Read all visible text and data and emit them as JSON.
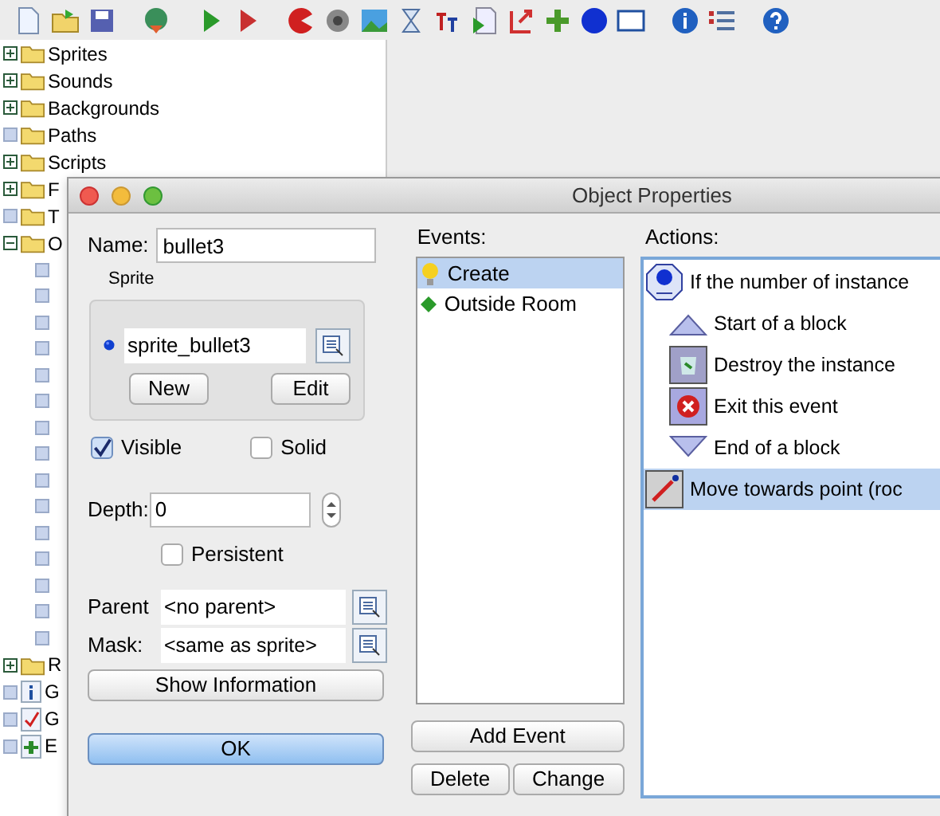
{
  "tree": [
    {
      "label": "Sprites",
      "expanded": false
    },
    {
      "label": "Sounds",
      "expanded": false
    },
    {
      "label": "Backgrounds",
      "expanded": false
    },
    {
      "label": "Paths"
    },
    {
      "label": "Scripts",
      "expanded": false
    },
    {
      "label": "F",
      "expanded": false
    },
    {
      "label": "T"
    },
    {
      "label": "O",
      "expanded": true,
      "children": [
        {
          "kind": "object"
        },
        {
          "kind": "object"
        },
        {
          "kind": "object"
        },
        {
          "kind": "object"
        },
        {
          "kind": "object"
        },
        {
          "kind": "object"
        },
        {
          "kind": "object"
        },
        {
          "kind": "object"
        },
        {
          "kind": "object"
        },
        {
          "kind": "object"
        },
        {
          "kind": "object"
        },
        {
          "kind": "object"
        },
        {
          "kind": "object"
        },
        {
          "kind": "object"
        },
        {
          "kind": "object"
        }
      ]
    },
    {
      "label": "R",
      "expanded": false,
      "kind": "folder"
    },
    {
      "label": "G",
      "kind": "info"
    },
    {
      "label": "G",
      "kind": "settings"
    },
    {
      "label": "E",
      "kind": "extension"
    }
  ],
  "dialog": {
    "title": "Object Properties",
    "name_label": "Name:",
    "name_value": "bullet3",
    "sprite_group": "Sprite",
    "sprite_value": "sprite_bullet3",
    "new_button": "New",
    "edit_button": "Edit",
    "visible": {
      "label": "Visible",
      "checked": true
    },
    "solid": {
      "label": "Solid",
      "checked": false
    },
    "depth_label": "Depth:",
    "depth_value": "0",
    "persistent": {
      "label": "Persistent",
      "checked": false
    },
    "parent_label": "Parent",
    "parent_value": "<no parent>",
    "mask_label": "Mask:",
    "mask_value": "<same as sprite>",
    "show_info_button": "Show Information",
    "ok_button": "OK",
    "events_label": "Events:",
    "events": [
      {
        "label": "Create",
        "kind": "create",
        "selected": true
      },
      {
        "label": "Outside Room",
        "kind": "other",
        "selected": false
      }
    ],
    "add_event_button": "Add Event",
    "delete_button": "Delete",
    "change_button": "Change",
    "actions_label": "Actions:",
    "actions": [
      {
        "label": "If the number of instance",
        "kind": "test",
        "selected": false,
        "children": [
          {
            "label": "Start of a block",
            "kind": "block_start",
            "selected": false
          },
          {
            "label": "Destroy the instance",
            "kind": "destroy",
            "selected": false
          },
          {
            "label": "Exit this event",
            "kind": "exit",
            "selected": false
          },
          {
            "label": "End of a block",
            "kind": "block_end",
            "selected": false
          }
        ]
      },
      {
        "label": "Move towards point (roc",
        "kind": "move",
        "selected": true
      }
    ]
  }
}
